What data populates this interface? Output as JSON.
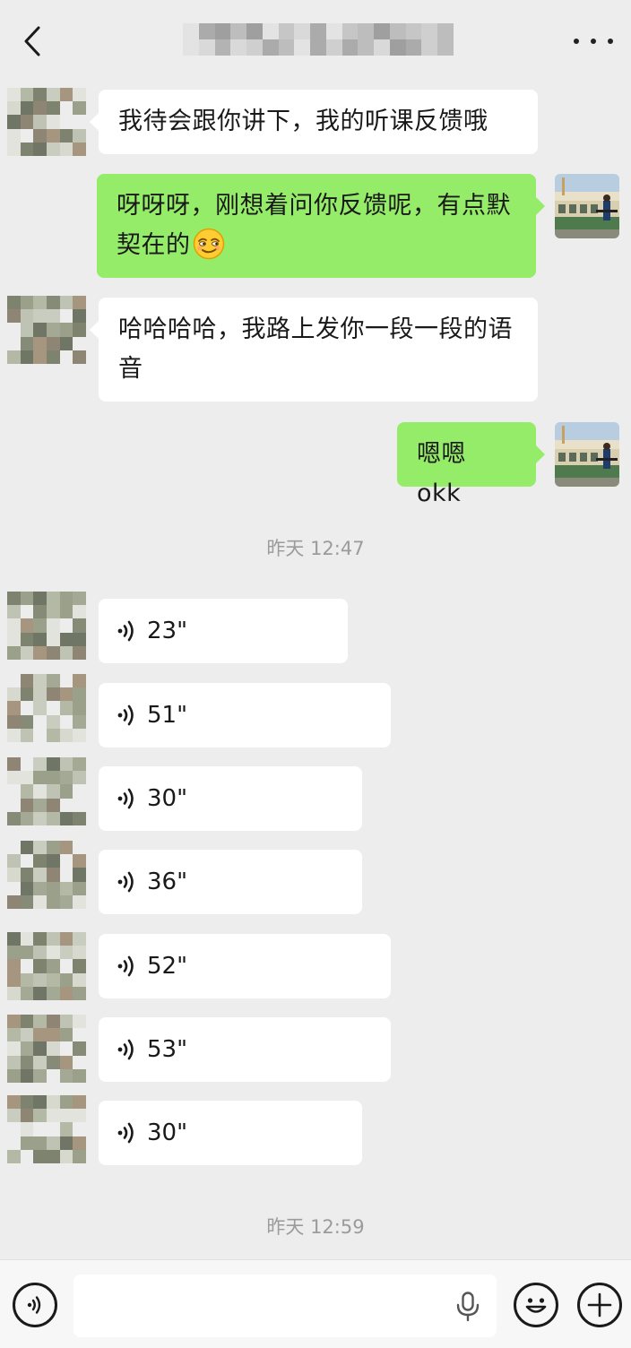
{
  "header": {
    "back_icon": "chevron-left-icon",
    "title": "",
    "more_icon": "more-dots-icon"
  },
  "messages": [
    {
      "side": "left",
      "text": "我待会跟你讲下，我的听课反馈哦"
    },
    {
      "side": "right",
      "text": "呀呀呀，刚想着问你反馈呢，有点默契在的",
      "emoji": "smirk-face-emoji"
    },
    {
      "side": "left",
      "text": "哈哈哈哈，我路上发你一段一段的语音"
    },
    {
      "side": "right",
      "text": "嗯嗯 okk"
    }
  ],
  "timestamps": [
    "昨天 12:47",
    "昨天 12:59"
  ],
  "voice_messages": [
    {
      "duration": "23\""
    },
    {
      "duration": "51\""
    },
    {
      "duration": "30\""
    },
    {
      "duration": "36\""
    },
    {
      "duration": "52\""
    },
    {
      "duration": "53\""
    },
    {
      "duration": "30\""
    }
  ],
  "input_bar": {
    "voice_toggle_icon": "voice-toggle-icon",
    "input_value": "",
    "mic_icon": "microphone-icon",
    "emoji_icon": "emoji-icon",
    "plus_icon": "plus-icon"
  },
  "colors": {
    "background": "#ededed",
    "bubble_self": "#95ec69",
    "bubble_other": "#ffffff",
    "timestamp_text": "#9b9b9b"
  }
}
